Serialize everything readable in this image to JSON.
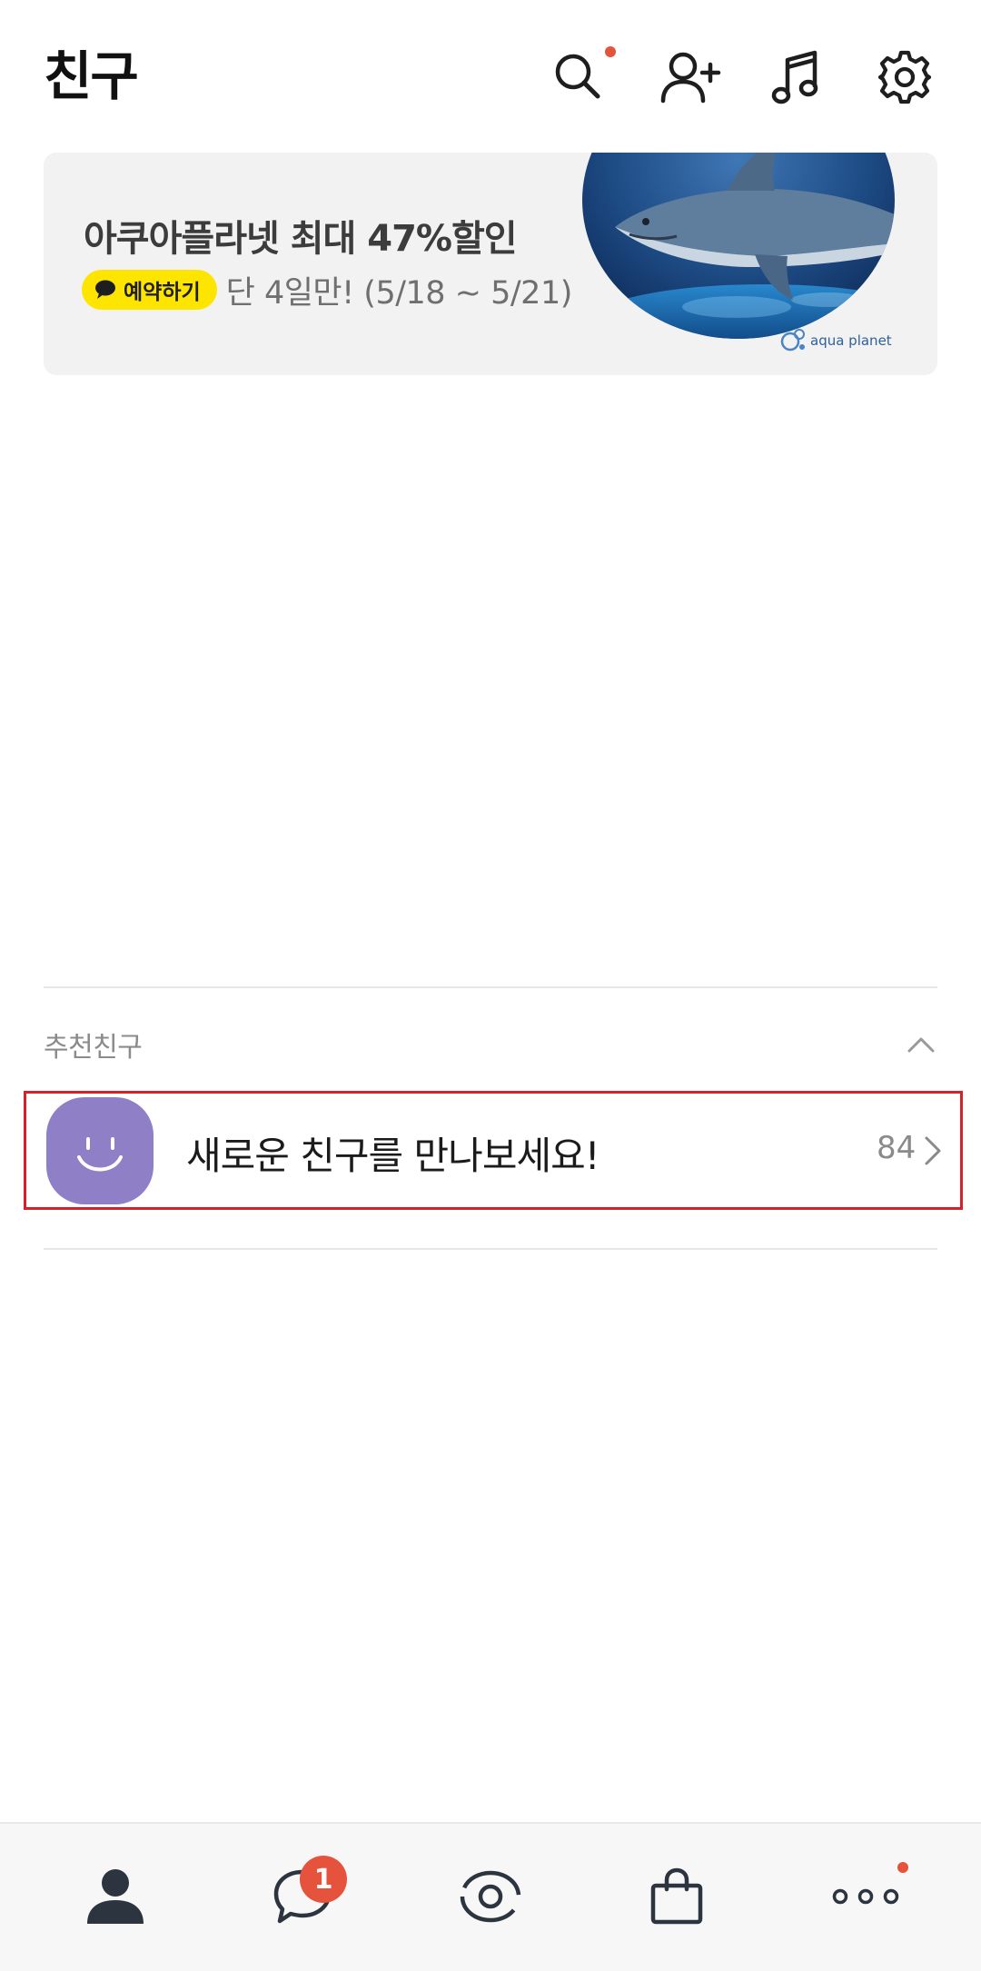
{
  "header": {
    "title": "친구",
    "icons": [
      "search-icon",
      "add-friend-icon",
      "music-icon",
      "gear-icon"
    ],
    "search_has_new": true
  },
  "banner": {
    "title": "아쿠아플라넷 최대 47%할인",
    "badge_label": "예약하기",
    "subtitle": "단 4일만! (5/18 ~ 5/21)",
    "brand": "aqua planet"
  },
  "recommended": {
    "section_title": "추천친구",
    "row_label": "새로운 친구를 만나보세요!",
    "count": "84"
  },
  "bottom_nav": {
    "items": [
      "friends-tab",
      "chats-tab",
      "view-tab",
      "shopping-tab",
      "more-tab"
    ],
    "chat_badge": "1",
    "more_has_new": true
  },
  "colors": {
    "accent_yellow": "#fee500",
    "badge_red": "#e5533c",
    "avatar_purple": "#8e7fc6",
    "highlight_border": "#d4212a"
  }
}
